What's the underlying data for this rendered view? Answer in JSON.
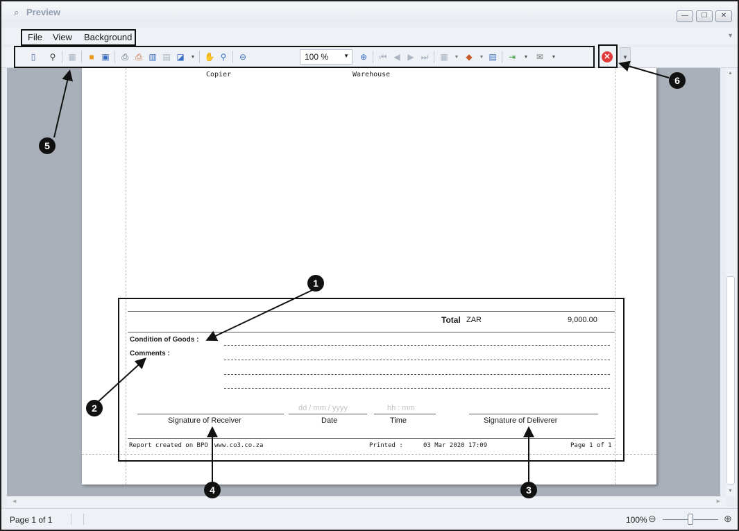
{
  "window": {
    "title": "Preview",
    "minimize_glyph": "—",
    "maximize_glyph": "☐",
    "close_glyph": "✕"
  },
  "menu": {
    "items": [
      "File",
      "View",
      "Background"
    ]
  },
  "toolbar": {
    "icons": [
      "panel-layout-icon",
      "binoculars-icon",
      "grid-icon",
      "open-folder-icon",
      "save-icon",
      "print-icon",
      "quick-print-icon",
      "page-setup-icon",
      "margins-icon",
      "scale-icon",
      "hand-tool-icon",
      "magnifier-icon",
      "zoom-out-icon",
      "zoom-in-icon",
      "first-page-icon",
      "previous-page-icon",
      "next-page-icon",
      "last-page-icon",
      "multiple-pages-icon",
      "color-icon",
      "watermark-icon",
      "export-icon",
      "email-icon",
      "close-preview-icon"
    ],
    "zoom_value": "100 %"
  },
  "report": {
    "top_row": {
      "item": "Copier",
      "location": "Warehouse"
    },
    "total_label": "Total",
    "currency": "ZAR",
    "total_value": "9,000.00",
    "condition_label": "Condition of Goods :",
    "comments_label": "Comments :",
    "date_placeholder": "dd / mm / yyyy",
    "time_placeholder": "hh : mm",
    "sig_receiver": "Signature of Receiver",
    "date_label": "Date",
    "time_label": "Time",
    "sig_deliverer": "Signature of Deliverer",
    "created_text": "Report created on BPO",
    "website": "www.co3.co.za",
    "printed_label": "Printed :",
    "printed_date": "03 Mar 2020 17:09",
    "page_text": "Page 1 of 1"
  },
  "callouts": [
    "1",
    "2",
    "3",
    "4",
    "5",
    "6"
  ],
  "status": {
    "page": "Page 1 of 1",
    "zoom": "100%",
    "zoom_level": 0.5
  }
}
